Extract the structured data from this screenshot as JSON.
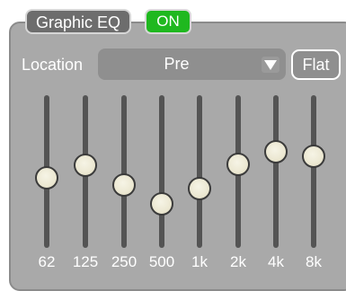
{
  "header": {
    "title": "Graphic EQ",
    "power_label": "ON"
  },
  "location": {
    "label": "Location",
    "value": "Pre",
    "flat_label": "Flat"
  },
  "bands": [
    {
      "label": "62",
      "level": 0.46
    },
    {
      "label": "125",
      "level": 0.54
    },
    {
      "label": "250",
      "level": 0.41
    },
    {
      "label": "500",
      "level": 0.29
    },
    {
      "label": "1k",
      "level": 0.39
    },
    {
      "label": "2k",
      "level": 0.55
    },
    {
      "label": "4k",
      "level": 0.63
    },
    {
      "label": "8k",
      "level": 0.6
    }
  ],
  "colors": {
    "panel": "#a9a9a9",
    "on_green": "#1fb81f",
    "knob": "#ece8d2",
    "track": "#545454"
  }
}
